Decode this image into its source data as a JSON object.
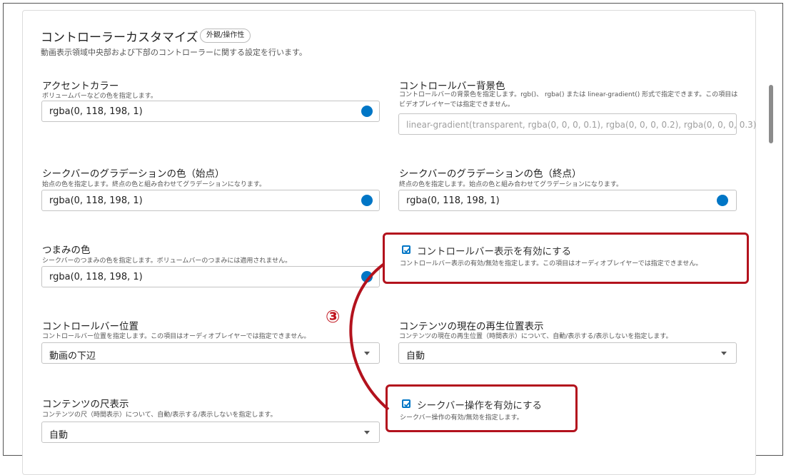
{
  "section": {
    "title": "コントローラーカスタマイズ",
    "chip": "外観/操作性",
    "description": "動画表示領域中央部および下部のコントローラーに関する設定を行います。"
  },
  "fields": {
    "accent_color": {
      "label": "アクセントカラー",
      "help": "ボリュームバーなどの色を指定します。",
      "value": "rgba(0, 118, 198, 1)"
    },
    "controlbar_bg": {
      "label": "コントロールバー背景色",
      "help": "コントロールバーの背景色を指定します。rgb()、 rgba() または linear-gradient() 形式で指定できます。この項目はビデオプレイヤーでは指定できません。",
      "placeholder": "linear-gradient(transparent, rgba(0, 0, 0, 0.1), rgba(0, 0, 0, 0.2), rgba(0, 0, 0, 0.3)"
    },
    "seek_grad_start": {
      "label": "シークバーのグラデーションの色（始点）",
      "help": "始点の色を指定します。終点の色と組み合わせてグラデーションになります。",
      "value": "rgba(0, 118, 198, 1)"
    },
    "seek_grad_end": {
      "label": "シークバーのグラデーションの色（終点）",
      "help": "終点の色を指定します。始点の色と組み合わせてグラデーションになります。",
      "value": "rgba(0, 118, 198, 1)"
    },
    "knob_color": {
      "label": "つまみの色",
      "help": "シークバーのつまみの色を指定します。ボリュームバーのつまみには適用されません。",
      "value": "rgba(0, 118, 198, 1)"
    },
    "controlbar_display": {
      "label": "コントロールバー表示を有効にする",
      "help": "コントロールバー表示の有効/無効を指定します。この項目はオーディオプレイヤーでは指定できません。",
      "checked": true
    },
    "controlbar_position": {
      "label": "コントロールバー位置",
      "help": "コントロールバー位置を指定します。この項目はオーディオプレイヤーでは指定できません。",
      "value": "動画の下辺"
    },
    "current_position": {
      "label": "コンテンツの現在の再生位置表示",
      "help": "コンテンツの現在の再生位置（時間表示）について、自動/表示する/表示しないを指定します。",
      "value": "自動"
    },
    "seek_operation": {
      "label": "シークバー操作を有効にする",
      "help": "シークバー操作の有効/無効を指定します。",
      "checked": true
    },
    "duration_display": {
      "label": "コンテンツの尺表示",
      "help": "コンテンツの尺（時間表示）について、自動/表示する/表示しないを指定します。",
      "value": "自動"
    }
  },
  "annotation": {
    "callout": "③",
    "color": "#b3121d"
  },
  "colors": {
    "accent": "#0076c6"
  }
}
